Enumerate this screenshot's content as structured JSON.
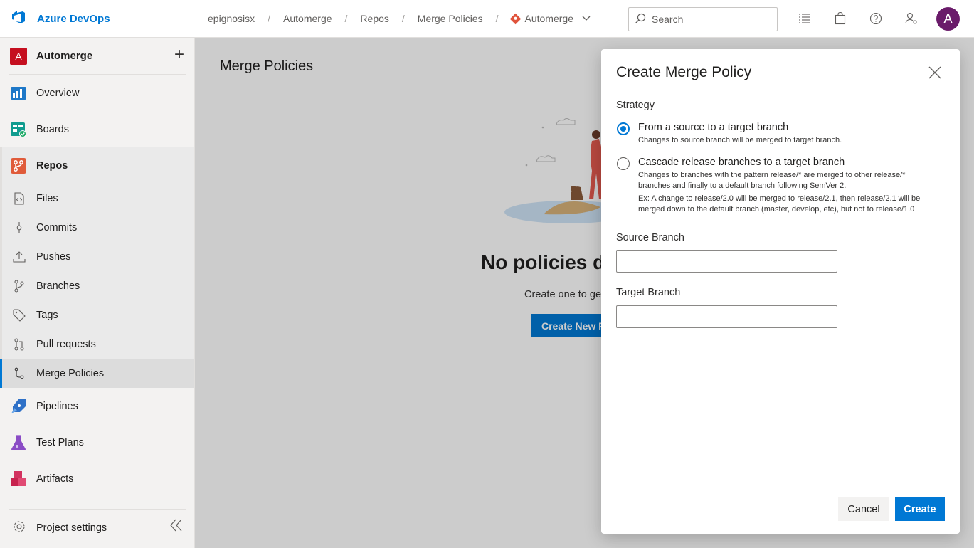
{
  "app": {
    "name": "Azure DevOps"
  },
  "breadcrumb": {
    "org": "epignosisx",
    "project": "Automerge",
    "section": "Repos",
    "page": "Merge Policies",
    "repo": "Automerge"
  },
  "search": {
    "placeholder": "Search"
  },
  "user": {
    "initial": "A"
  },
  "sidebar": {
    "project_initial": "A",
    "project_name": "Automerge",
    "items": [
      {
        "label": "Overview",
        "icon": "overview-icon"
      },
      {
        "label": "Boards",
        "icon": "boards-icon"
      },
      {
        "label": "Repos",
        "icon": "repos-icon"
      }
    ],
    "repo_items": [
      {
        "label": "Files",
        "icon": "files-icon"
      },
      {
        "label": "Commits",
        "icon": "commits-icon"
      },
      {
        "label": "Pushes",
        "icon": "pushes-icon"
      },
      {
        "label": "Branches",
        "icon": "branches-icon"
      },
      {
        "label": "Tags",
        "icon": "tags-icon"
      },
      {
        "label": "Pull requests",
        "icon": "pull-requests-icon"
      },
      {
        "label": "Merge Policies",
        "icon": "merge-policies-icon",
        "selected": true
      }
    ],
    "lower_items": [
      {
        "label": "Pipelines",
        "icon": "pipelines-icon"
      },
      {
        "label": "Test Plans",
        "icon": "test-plans-icon"
      },
      {
        "label": "Artifacts",
        "icon": "artifacts-icon"
      }
    ],
    "settings_label": "Project settings"
  },
  "main": {
    "title": "Merge Policies",
    "empty_title": "No policies de",
    "empty_subtitle": "Create one to ge",
    "create_button": "Create New P"
  },
  "dialog": {
    "title": "Create Merge Policy",
    "strategy_label": "Strategy",
    "options": [
      {
        "label": "From a source to a target branch",
        "description": "Changes to source branch will be merged to target branch.",
        "checked": true
      },
      {
        "label": "Cascade release branches to a target branch",
        "description_prefix": "Changes to branches with the pattern release/* are merged to other release/* branches and finally to a default branch following ",
        "description_link": "SemVer 2.",
        "example": "Ex: A change to release/2.0 will be merged to release/2.1, then release/2.1 will be merged down to the default branch (master, develop, etc), but not to release/1.0",
        "checked": false
      }
    ],
    "source_label": "Source Branch",
    "source_value": "",
    "target_label": "Target Branch",
    "target_value": "",
    "cancel_label": "Cancel",
    "create_label": "Create"
  },
  "colors": {
    "accent": "#0078d4",
    "project_badge": "#c50f1f",
    "avatar": "#6a1b6a"
  }
}
